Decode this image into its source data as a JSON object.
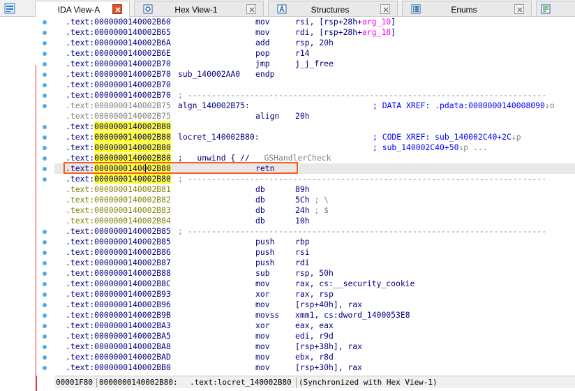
{
  "tabs": [
    {
      "label": "IDA View-A",
      "active": true,
      "icon": "grid-icon"
    },
    {
      "label": "Hex View-1",
      "active": false,
      "icon": "hex-view-icon"
    },
    {
      "label": "Structures",
      "active": false,
      "icon": "structures-icon"
    },
    {
      "label": "Enums",
      "active": false,
      "icon": "enums-icon"
    }
  ],
  "colors": {
    "highlight": "#ffff33",
    "accent": "#ff5a1f",
    "flow_arrow": "#e53232",
    "bullet": "#56a7e6",
    "code": "#000080"
  },
  "listing": [
    {
      "seg": ".text:",
      "addr": "0000000140002B60",
      "label": "",
      "mnem": "mov",
      "ops": "rsi, [rsp+28h+",
      "ops2": "arg_10",
      "ops3": "]",
      "comment": ""
    },
    {
      "seg": ".text:",
      "addr": "0000000140002B65",
      "label": "",
      "mnem": "mov",
      "ops": "rdi, [rsp+28h+",
      "ops2": "arg_18",
      "ops3": "]",
      "comment": ""
    },
    {
      "seg": ".text:",
      "addr": "0000000140002B6A",
      "label": "",
      "mnem": "add",
      "ops": "rsp, 20h",
      "ops2": "",
      "ops3": "",
      "comment": ""
    },
    {
      "seg": ".text:",
      "addr": "0000000140002B6E",
      "label": "",
      "mnem": "pop",
      "ops": "r14",
      "ops2": "",
      "ops3": "",
      "comment": ""
    },
    {
      "seg": ".text:",
      "addr": "0000000140002B70",
      "label": "",
      "mnem": "jmp",
      "ops": "j_j_free",
      "ops2": "",
      "ops3": "",
      "comment": ""
    },
    {
      "seg": ".text:",
      "addr": "0000000140002B70",
      "label": "sub_140002AA0",
      "mnem": "endp",
      "ops": "",
      "ops2": "",
      "ops3": "",
      "comment": ""
    },
    {
      "seg": ".text:",
      "addr": "0000000140002B70",
      "label": "",
      "mnem": "",
      "ops": "",
      "ops2": "",
      "ops3": "",
      "comment": ""
    },
    {
      "seg": ".text:",
      "addr": "0000000140002B70",
      "sep": "; ---------------------------------------------------------------------------"
    },
    {
      "seg": ".text:",
      "addr": "0000000140002B75",
      "label": "algn_140002B75:",
      "mnem": "",
      "ops": "",
      "ops2": "",
      "ops3": "",
      "xref": "; DATA XREF: .pdata:0000000140008090",
      "xref_tail": "↓o",
      "dim": true
    },
    {
      "seg": ".text:",
      "addr": "0000000140002B75",
      "label": "",
      "mnem": "align",
      "ops": "20h",
      "ops2": "",
      "ops3": "",
      "comment": "",
      "dim": true
    },
    {
      "seg": ".text:",
      "addr": "0000000140002B80",
      "label": "",
      "mnem": "",
      "ops": "",
      "ops2": "",
      "ops3": "",
      "comment": "",
      "hl": true
    },
    {
      "seg": ".text:",
      "addr": "0000000140002B80",
      "label": "locret_140002B80:",
      "mnem": "",
      "ops": "",
      "ops2": "",
      "ops3": "",
      "xref": "; CODE XREF: sub_140002C40+2C",
      "xref_tail": "↓p",
      "hl": true
    },
    {
      "seg": ".text:",
      "addr": "0000000140002B80",
      "label": "",
      "mnem": "",
      "ops": "",
      "ops2": "",
      "ops3": "",
      "xref": "; sub_140002C40+50",
      "xref_tail": "↓p ...",
      "hl": true
    },
    {
      "seg": ".text:",
      "addr": "0000000140002B80",
      "seh": "; __unwind { // ",
      "seh_g": "__GSHandlerCheck",
      "hl": true
    },
    {
      "seg": ".text:",
      "addr": "0000000140002B80",
      "label": "",
      "mnem": "retn",
      "ops": "",
      "ops2": "",
      "ops3": "",
      "comment": "",
      "hl": true,
      "cur": true
    },
    {
      "seg": ".text:",
      "addr": "0000000140002B80",
      "sep": "; ---------------------------------------------------------------------------",
      "hl": true
    },
    {
      "seg": ".text:",
      "addr": "0000000140002B81",
      "label": "",
      "mnem": "db",
      "ops": "89h",
      "ops2": "",
      "ops3": "",
      "comment": "",
      "olive": true
    },
    {
      "seg": ".text:",
      "addr": "0000000140002B82",
      "label": "",
      "mnem": "db",
      "ops": "5Ch",
      "ops2": "",
      "ops3": "",
      "comment": "; \\",
      "olive": true
    },
    {
      "seg": ".text:",
      "addr": "0000000140002B83",
      "label": "",
      "mnem": "db",
      "ops": "24h",
      "ops2": "",
      "ops3": "",
      "comment": "; $",
      "olive": true
    },
    {
      "seg": ".text:",
      "addr": "0000000140002B84",
      "label": "",
      "mnem": "db",
      "ops": "10h",
      "ops2": "",
      "ops3": "",
      "comment": "",
      "olive": true
    },
    {
      "seg": ".text:",
      "addr": "0000000140002B85",
      "sep": "; ---------------------------------------------------------------------------"
    },
    {
      "seg": ".text:",
      "addr": "0000000140002B85",
      "label": "",
      "mnem": "push",
      "ops": "rbp",
      "ops2": "",
      "ops3": "",
      "comment": ""
    },
    {
      "seg": ".text:",
      "addr": "0000000140002B86",
      "label": "",
      "mnem": "push",
      "ops": "rsi",
      "ops2": "",
      "ops3": "",
      "comment": ""
    },
    {
      "seg": ".text:",
      "addr": "0000000140002B87",
      "label": "",
      "mnem": "push",
      "ops": "rdi",
      "ops2": "",
      "ops3": "",
      "comment": ""
    },
    {
      "seg": ".text:",
      "addr": "0000000140002B88",
      "label": "",
      "mnem": "sub",
      "ops": "rsp, 50h",
      "ops2": "",
      "ops3": "",
      "comment": ""
    },
    {
      "seg": ".text:",
      "addr": "0000000140002B8C",
      "label": "",
      "mnem": "mov",
      "ops": "rax, cs:",
      "ops2": "__security_cookie",
      "ops3": "",
      "comment": ""
    },
    {
      "seg": ".text:",
      "addr": "0000000140002B93",
      "label": "",
      "mnem": "xor",
      "ops": "rax, rsp",
      "ops2": "",
      "ops3": "",
      "comment": ""
    },
    {
      "seg": ".text:",
      "addr": "0000000140002B96",
      "label": "",
      "mnem": "mov",
      "ops": "[rsp+40h], rax",
      "ops2": "",
      "ops3": "",
      "comment": ""
    },
    {
      "seg": ".text:",
      "addr": "0000000140002B9B",
      "label": "",
      "mnem": "movss",
      "ops": "xmm1, cs:",
      "ops2": "dword_1400053E8",
      "ops3": "",
      "comment": ""
    },
    {
      "seg": ".text:",
      "addr": "0000000140002BA3",
      "label": "",
      "mnem": "xor",
      "ops": "eax, eax",
      "ops2": "",
      "ops3": "",
      "comment": ""
    },
    {
      "seg": ".text:",
      "addr": "0000000140002BA5",
      "label": "",
      "mnem": "mov",
      "ops": "edi, r9d",
      "ops2": "",
      "ops3": "",
      "comment": ""
    },
    {
      "seg": ".text:",
      "addr": "0000000140002BA8",
      "label": "",
      "mnem": "mov",
      "ops": "[rsp+38h], rax",
      "ops2": "",
      "ops3": "",
      "comment": ""
    },
    {
      "seg": ".text:",
      "addr": "0000000140002BAD",
      "label": "",
      "mnem": "mov",
      "ops": "ebx, r8d",
      "ops2": "",
      "ops3": "",
      "comment": ""
    },
    {
      "seg": ".text:",
      "addr": "0000000140002BB0",
      "label": "",
      "mnem": "mov",
      "ops": "[rsp+30h], rax",
      "ops2": "",
      "ops3": "",
      "comment": ""
    }
  ],
  "status": {
    "offset": "00001F80",
    "address": "0000000140002B80:",
    "location": ".text:locret_140002B80",
    "sync": "(Synchronized with Hex View-1)"
  }
}
